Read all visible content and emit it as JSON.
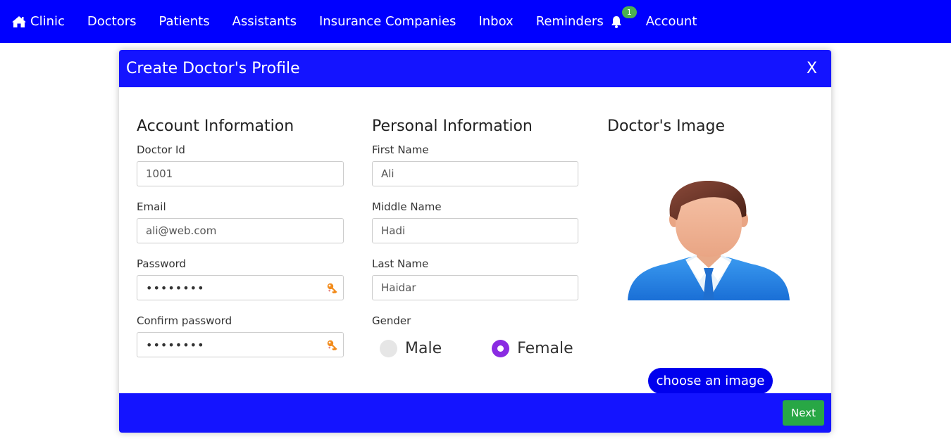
{
  "nav": {
    "brand": "Clinic",
    "items": [
      {
        "label": "Doctors"
      },
      {
        "label": "Patients"
      },
      {
        "label": "Assistants"
      },
      {
        "label": "Insurance Companies"
      },
      {
        "label": "Inbox"
      },
      {
        "label": "Reminders"
      },
      {
        "label": "Account"
      }
    ],
    "reminders_badge": "1",
    "icons": {
      "home": "home-icon",
      "bell": "bell-icon"
    }
  },
  "modal": {
    "title": "Create Doctor's Profile",
    "close_label": "X",
    "account": {
      "title": "Account Information",
      "doctor_id_label": "Doctor Id",
      "doctor_id_value": "1001",
      "email_label": "Email",
      "email_value": "ali@web.com",
      "password_label": "Password",
      "password_value": "••••••••",
      "confirm_label": "Confirm password",
      "confirm_value": "••••••••"
    },
    "personal": {
      "title": "Personal Information",
      "first_name_label": "First Name",
      "first_name_value": "Ali",
      "middle_name_label": "Middle Name",
      "middle_name_value": "Hadi",
      "last_name_label": "Last Name",
      "last_name_value": "Haidar",
      "gender_label": "Gender",
      "gender_options": [
        "Male",
        "Female"
      ],
      "gender_selected": "Female"
    },
    "image": {
      "title": "Doctor's Image",
      "choose_label": "choose an image"
    },
    "next_label": "Next"
  },
  "colors": {
    "nav_bg": "#0000ff",
    "header_bg": "#1414ff",
    "next_bg": "#28a745",
    "badge_bg": "#4caf50",
    "radio_checked": "#8a2be2"
  }
}
